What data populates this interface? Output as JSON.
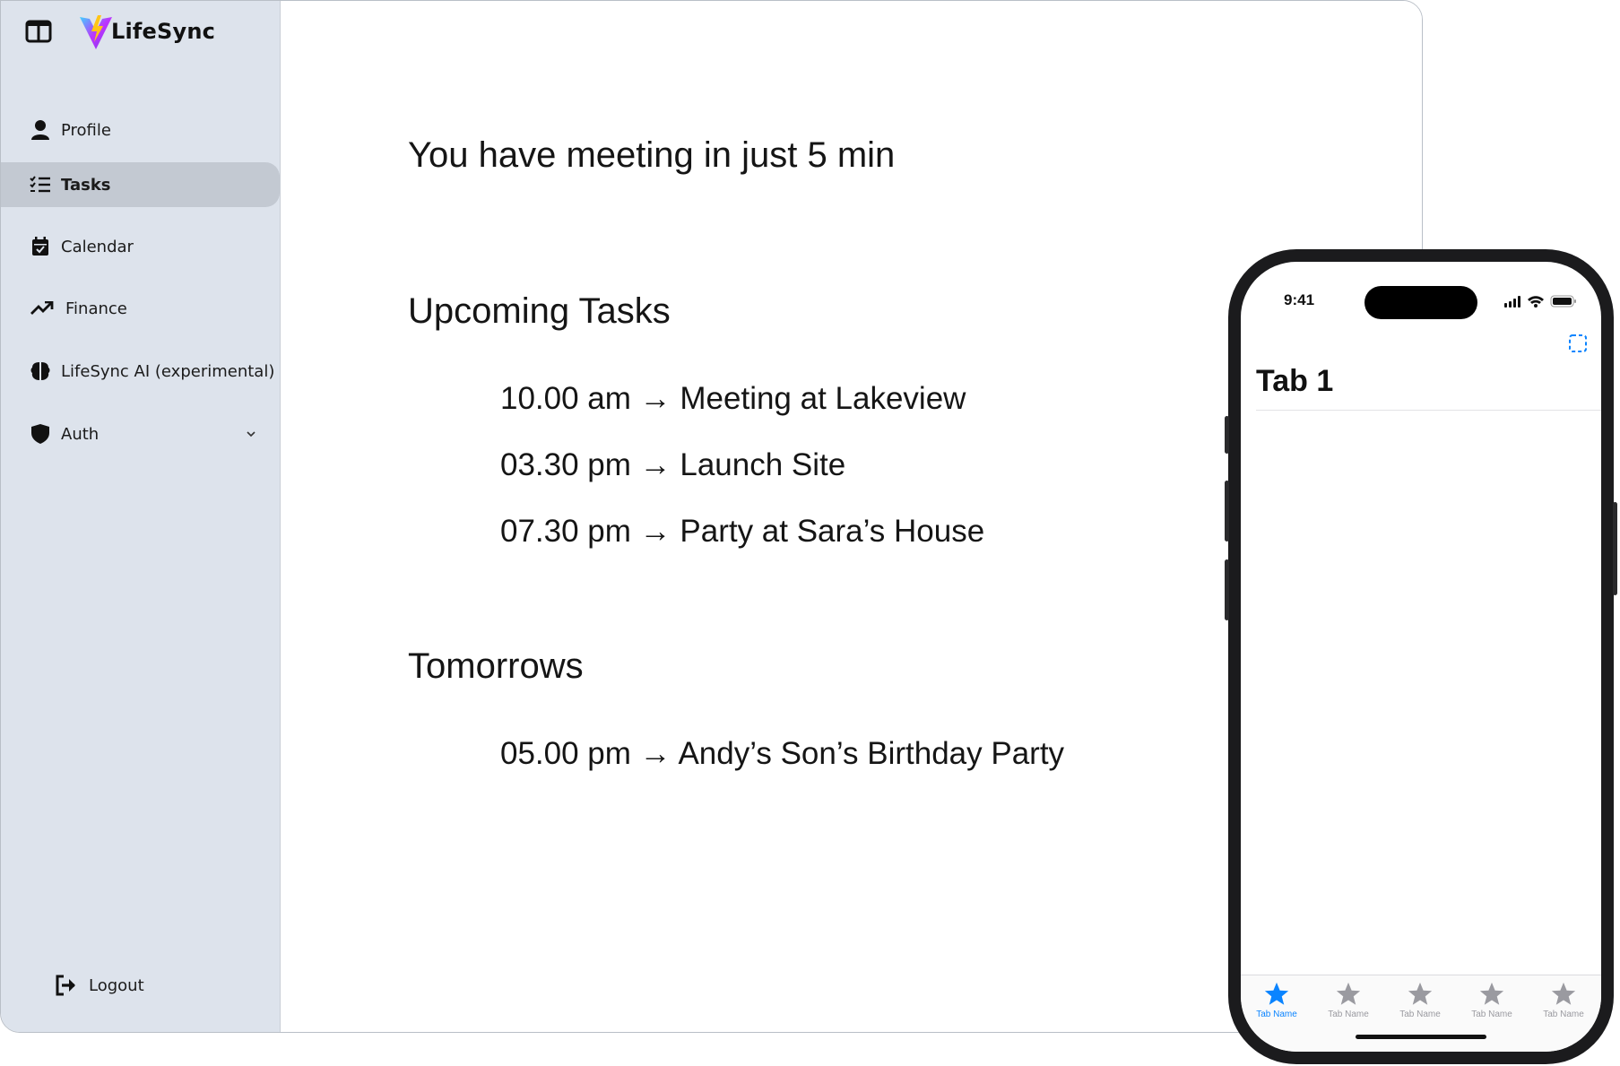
{
  "sidebar": {
    "brand": "LifeSync",
    "items": [
      {
        "label": "Profile",
        "icon": "person-icon"
      },
      {
        "label": "Tasks",
        "icon": "checklist-icon",
        "active": true
      },
      {
        "label": "Calendar",
        "icon": "calendar-icon"
      },
      {
        "label": "Finance",
        "icon": "trending-up-icon"
      },
      {
        "label": "LifeSync AI (experimental)",
        "icon": "brain-icon"
      },
      {
        "label": "Auth",
        "icon": "shield-icon"
      }
    ],
    "logout_label": "Logout"
  },
  "main": {
    "alert": "You have meeting in just 5 min",
    "upcoming": {
      "heading": "Upcoming Tasks",
      "tasks": [
        "10.00 am → Meeting at Lakeview",
        "03.30 pm → Launch Site",
        "07.30 pm → Party at Sara’s House"
      ]
    },
    "tomorrow": {
      "heading": "Tomorrows",
      "tasks": [
        "05.00 pm → Andy’s Son’s Birthday Party"
      ]
    }
  },
  "phone": {
    "time": "9:41",
    "title": "Tab 1",
    "tabs": [
      {
        "label": "Tab Name",
        "active": true
      },
      {
        "label": "Tab Name"
      },
      {
        "label": "Tab Name"
      },
      {
        "label": "Tab Name"
      },
      {
        "label": "Tab Name"
      }
    ],
    "accent": "#0a84ff"
  }
}
